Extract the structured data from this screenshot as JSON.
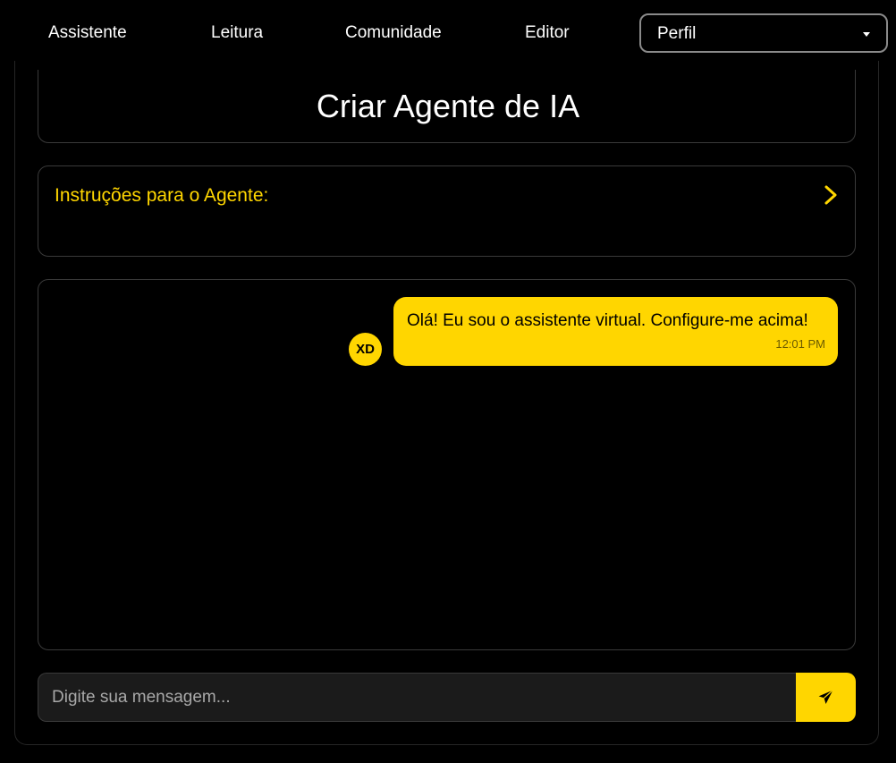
{
  "nav": {
    "items": [
      {
        "label": "Assistente"
      },
      {
        "label": "Leitura"
      },
      {
        "label": "Comunidade"
      },
      {
        "label": "Editor"
      }
    ],
    "profile_select": {
      "selected": "Perfil",
      "icon": "caret-down-icon"
    }
  },
  "page": {
    "title": "Criar Agente de IA"
  },
  "instructions": {
    "label": "Instruções para o Agente:",
    "icon": "chevron-right-icon"
  },
  "chat": {
    "messages": [
      {
        "avatar": "XD",
        "text": "Olá! Eu sou o assistente virtual. Configure-me acima!",
        "time": "12:01 PM"
      }
    ]
  },
  "composer": {
    "placeholder": "Digite sua mensagem...",
    "value": "",
    "send_icon": "paper-plane-icon"
  },
  "colors": {
    "accent": "#ffd600",
    "background": "#000000",
    "input_background": "#1b1b1b",
    "border": "#3a3a3a"
  }
}
